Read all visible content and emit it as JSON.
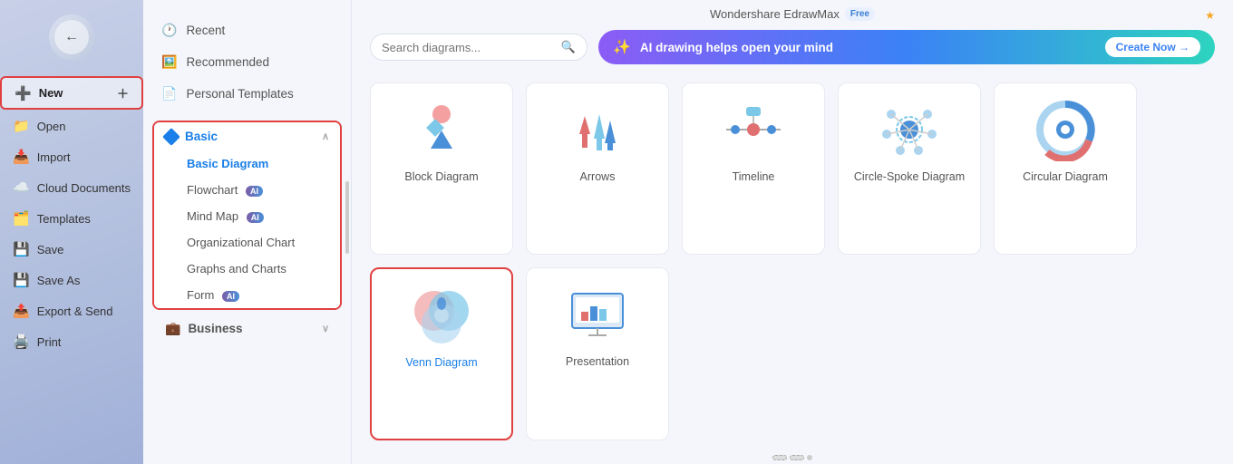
{
  "app": {
    "title": "Wondershare EdrawMax",
    "free_badge": "Free"
  },
  "left_sidebar": {
    "items": [
      {
        "id": "new",
        "label": "New",
        "icon": "➕",
        "active": true
      },
      {
        "id": "open",
        "label": "Open",
        "icon": "📁"
      },
      {
        "id": "import",
        "label": "Import",
        "icon": "📥"
      },
      {
        "id": "cloud",
        "label": "Cloud Documents",
        "icon": "☁️"
      },
      {
        "id": "templates",
        "label": "Templates",
        "icon": "🗂️"
      },
      {
        "id": "save",
        "label": "Save",
        "icon": "💾"
      },
      {
        "id": "saveas",
        "label": "Save As",
        "icon": "💾"
      },
      {
        "id": "export",
        "label": "Export & Send",
        "icon": "📤"
      },
      {
        "id": "print",
        "label": "Print",
        "icon": "🖨️"
      }
    ]
  },
  "middle_panel": {
    "nav_items": [
      {
        "id": "recent",
        "label": "Recent",
        "icon": "🕐"
      },
      {
        "id": "recommended",
        "label": "Recommended",
        "icon": "🖼️"
      },
      {
        "id": "personal",
        "label": "Personal Templates",
        "icon": "📄"
      }
    ],
    "basic_category": {
      "label": "Basic",
      "sub_items": [
        {
          "id": "basic_diagram",
          "label": "Basic Diagram",
          "selected": true
        },
        {
          "id": "flowchart",
          "label": "Flowchart",
          "has_ai": true
        },
        {
          "id": "mind_map",
          "label": "Mind Map",
          "has_ai": true
        },
        {
          "id": "org_chart",
          "label": "Organizational Chart"
        },
        {
          "id": "graphs_charts",
          "label": "Graphs and Charts"
        },
        {
          "id": "form",
          "label": "Form",
          "has_ai": true
        }
      ]
    },
    "business_category": {
      "label": "Business"
    }
  },
  "search": {
    "placeholder": "Search diagrams..."
  },
  "ai_banner": {
    "text": "AI drawing helps open your mind",
    "cta": "Create Now →"
  },
  "diagrams": [
    {
      "id": "block",
      "label": "Block Diagram"
    },
    {
      "id": "arrows",
      "label": "Arrows"
    },
    {
      "id": "timeline",
      "label": "Timeline"
    },
    {
      "id": "circle_spoke",
      "label": "Circle-Spoke Diagram"
    },
    {
      "id": "circular",
      "label": "Circular Diagram"
    },
    {
      "id": "venn",
      "label": "Venn Diagram",
      "selected": true
    },
    {
      "id": "presentation",
      "label": "Presentation"
    }
  ]
}
